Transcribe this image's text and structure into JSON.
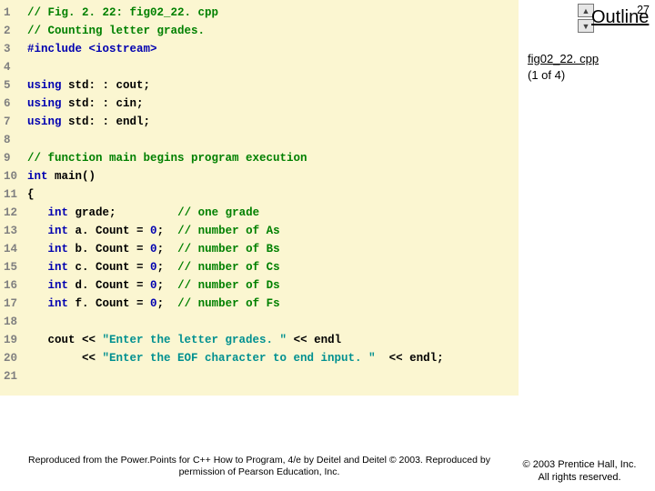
{
  "slide": {
    "pageNumber": "27",
    "outlineLabel": "Outline",
    "figRefLine1": "fig02_22. cpp",
    "figRefLine2": "(1 of 4)",
    "copyright1": "© 2003 Prentice Hall, Inc.",
    "copyright2": "All rights reserved.",
    "attrib1": "Reproduced from the Power.Points for C++ How to Program, 4/e by Deitel and Deitel © 2003. Reproduced by",
    "attrib2": "permission of Pearson Education, Inc."
  },
  "arrows": {
    "up": "▲",
    "down": "▼"
  },
  "code": {
    "lines": [
      {
        "n": "1",
        "seg": [
          {
            "c": "cm",
            "t": "// Fig. 2. 22: fig02_22. cpp"
          }
        ]
      },
      {
        "n": "2",
        "seg": [
          {
            "c": "cm",
            "t": "// Counting letter grades."
          }
        ]
      },
      {
        "n": "3",
        "seg": [
          {
            "c": "pp",
            "t": "#include "
          },
          {
            "c": "pp",
            "t": "<iostream>"
          }
        ]
      },
      {
        "n": "4",
        "seg": [
          {
            "c": "pl",
            "t": ""
          }
        ]
      },
      {
        "n": "5",
        "seg": [
          {
            "c": "kw",
            "t": "using "
          },
          {
            "c": "pl",
            "t": "std: : cout;"
          }
        ]
      },
      {
        "n": "6",
        "seg": [
          {
            "c": "kw",
            "t": "using "
          },
          {
            "c": "pl",
            "t": "std: : cin;"
          }
        ]
      },
      {
        "n": "7",
        "seg": [
          {
            "c": "kw",
            "t": "using "
          },
          {
            "c": "pl",
            "t": "std: : endl;"
          }
        ]
      },
      {
        "n": "8",
        "seg": [
          {
            "c": "pl",
            "t": ""
          }
        ]
      },
      {
        "n": "9",
        "seg": [
          {
            "c": "cm",
            "t": "// function main begins program execution"
          }
        ]
      },
      {
        "n": "10",
        "seg": [
          {
            "c": "kw",
            "t": "int "
          },
          {
            "c": "pl",
            "t": "main()"
          }
        ]
      },
      {
        "n": "11",
        "seg": [
          {
            "c": "pl",
            "t": "{"
          }
        ]
      },
      {
        "n": "12",
        "seg": [
          {
            "c": "pl",
            "t": "   "
          },
          {
            "c": "kw",
            "t": "int "
          },
          {
            "c": "pl",
            "t": "grade;         "
          },
          {
            "c": "cm",
            "t": "// one grade"
          }
        ]
      },
      {
        "n": "13",
        "seg": [
          {
            "c": "pl",
            "t": "   "
          },
          {
            "c": "kw",
            "t": "int "
          },
          {
            "c": "pl",
            "t": "a. Count = "
          },
          {
            "c": "kw",
            "t": "0"
          },
          {
            "c": "pl",
            "t": ";  "
          },
          {
            "c": "cm",
            "t": "// number of As"
          }
        ]
      },
      {
        "n": "14",
        "seg": [
          {
            "c": "pl",
            "t": "   "
          },
          {
            "c": "kw",
            "t": "int "
          },
          {
            "c": "pl",
            "t": "b. Count = "
          },
          {
            "c": "kw",
            "t": "0"
          },
          {
            "c": "pl",
            "t": ";  "
          },
          {
            "c": "cm",
            "t": "// number of Bs"
          }
        ]
      },
      {
        "n": "15",
        "seg": [
          {
            "c": "pl",
            "t": "   "
          },
          {
            "c": "kw",
            "t": "int "
          },
          {
            "c": "pl",
            "t": "c. Count = "
          },
          {
            "c": "kw",
            "t": "0"
          },
          {
            "c": "pl",
            "t": ";  "
          },
          {
            "c": "cm",
            "t": "// number of Cs"
          }
        ]
      },
      {
        "n": "16",
        "seg": [
          {
            "c": "pl",
            "t": "   "
          },
          {
            "c": "kw",
            "t": "int "
          },
          {
            "c": "pl",
            "t": "d. Count = "
          },
          {
            "c": "kw",
            "t": "0"
          },
          {
            "c": "pl",
            "t": ";  "
          },
          {
            "c": "cm",
            "t": "// number of Ds"
          }
        ]
      },
      {
        "n": "17",
        "seg": [
          {
            "c": "pl",
            "t": "   "
          },
          {
            "c": "kw",
            "t": "int "
          },
          {
            "c": "pl",
            "t": "f. Count = "
          },
          {
            "c": "kw",
            "t": "0"
          },
          {
            "c": "pl",
            "t": ";  "
          },
          {
            "c": "cm",
            "t": "// number of Fs"
          }
        ]
      },
      {
        "n": "18",
        "seg": [
          {
            "c": "pl",
            "t": ""
          }
        ]
      },
      {
        "n": "19",
        "seg": [
          {
            "c": "pl",
            "t": "   cout << "
          },
          {
            "c": "st",
            "t": "\"Enter the letter grades. \""
          },
          {
            "c": "pl",
            "t": " << endl"
          }
        ]
      },
      {
        "n": "20",
        "seg": [
          {
            "c": "pl",
            "t": "        << "
          },
          {
            "c": "st",
            "t": "\"Enter the EOF character to end input. \" "
          },
          {
            "c": "pl",
            "t": " << endl;"
          }
        ]
      },
      {
        "n": "21",
        "seg": [
          {
            "c": "pl",
            "t": ""
          }
        ]
      }
    ]
  }
}
